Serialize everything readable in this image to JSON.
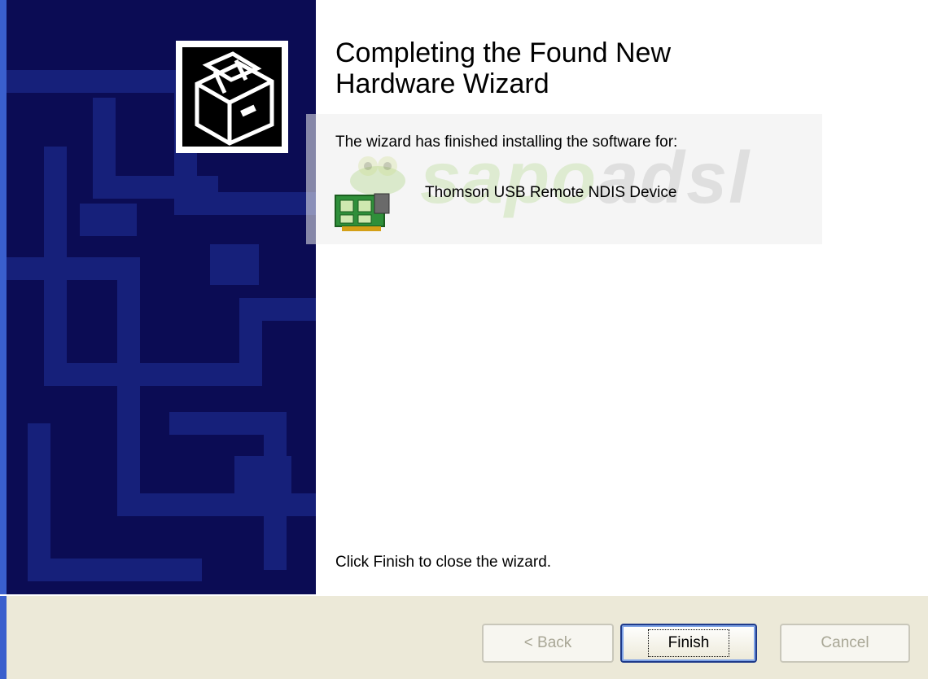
{
  "wizard": {
    "title": "Completing the Found New Hardware Wizard",
    "intro": "The wizard has finished installing the software for:",
    "device_name": "Thomson USB Remote NDIS Device",
    "finish_instruction": "Click Finish to close the wizard.",
    "watermark_text": "sapo",
    "watermark_text_2": "adsl"
  },
  "buttons": {
    "back": "< Back",
    "finish": "Finish",
    "cancel": "Cancel"
  },
  "icons": {
    "wizard": "hardware-install-icon",
    "device": "network-card-icon",
    "watermark": "frog-logo"
  },
  "colors": {
    "sidebar_bg": "#0b0c54",
    "sidebar_shapes": "#1a237e",
    "button_bar_bg": "#ece9d8",
    "accent_border": "#1e3a8a"
  }
}
